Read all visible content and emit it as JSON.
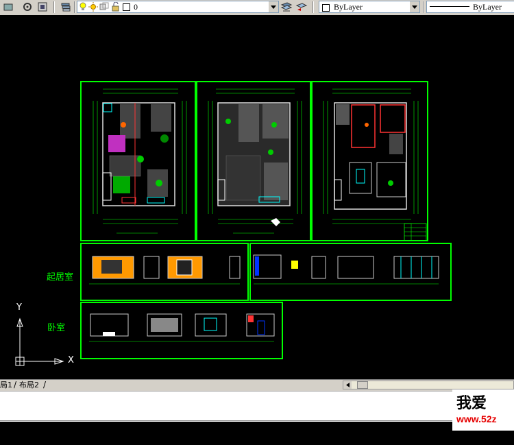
{
  "toolbar": {
    "layer_name": "0",
    "color_combo": "ByLayer",
    "linetype_combo": "ByLayer"
  },
  "canvas": {
    "label_living_room": "起居室",
    "label_bedroom": "卧室",
    "ucs_x": "X",
    "ucs_y": "Y"
  },
  "tabs": {
    "layout1": "局1",
    "layout2": "布局2"
  },
  "watermark": {
    "brand": "我爱",
    "url": "www.52z"
  },
  "colors": {
    "drawing": "#00ff00",
    "background": "#000000",
    "toolbar": "#d4d0c8"
  }
}
